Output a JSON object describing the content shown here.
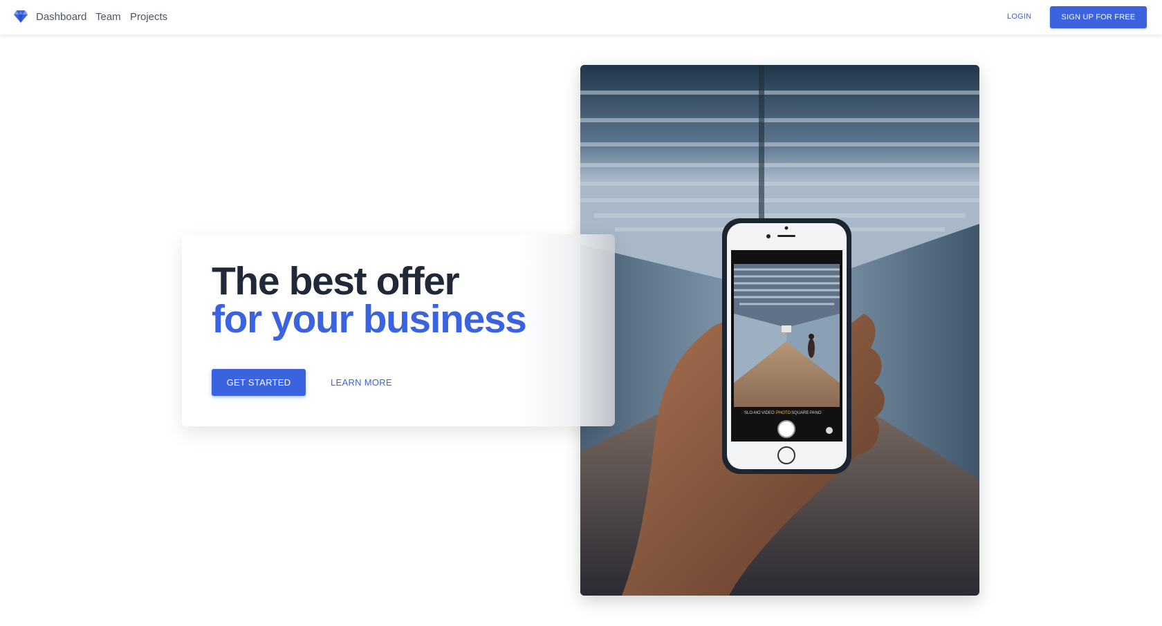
{
  "nav": {
    "brand_icon": "diamond-icon",
    "links": [
      "Dashboard",
      "Team",
      "Projects"
    ],
    "login_label": "LOGIN",
    "signup_label": "SIGN UP FOR FREE"
  },
  "hero": {
    "headline_line1": "The best offer",
    "headline_line2": "for your business",
    "primary_cta": "GET STARTED",
    "secondary_cta": "LEARN MORE",
    "image_alt": "hand holding a phone photographing a corridor"
  },
  "colors": {
    "accent": "#3b63e0",
    "heading": "#1f2937",
    "nav_text": "#4b5563"
  }
}
